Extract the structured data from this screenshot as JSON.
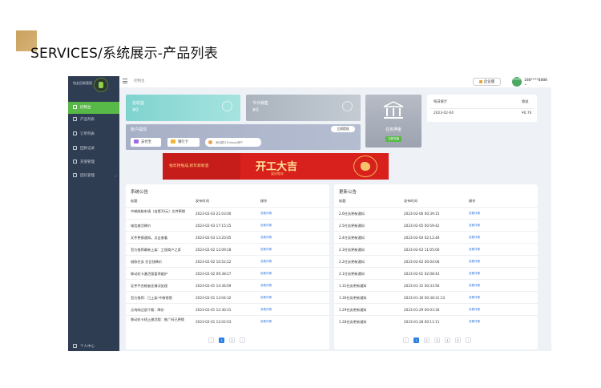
{
  "page": {
    "title": "SERVICES/系统展示-产品列表"
  },
  "sidebar": {
    "logo_text": "铭友回收管理",
    "items": [
      {
        "label": "控制台",
        "active": true
      },
      {
        "label": "产品列表",
        "active": false
      },
      {
        "label": "订单列表",
        "active": false
      },
      {
        "label": "回款记录",
        "active": false
      },
      {
        "label": "充值管理",
        "active": false
      },
      {
        "label": "团队管理",
        "active": false,
        "arrow": "›"
      }
    ],
    "user_center": "个人中心"
  },
  "topbar": {
    "breadcrumb": "控制台",
    "version_button": "企业版",
    "avatar_text": "铭友回收",
    "phone": "188****8888 ⌄"
  },
  "cards": {
    "total_earnings": {
      "label": "总收益",
      "value": "¥0"
    },
    "today_sales": {
      "label": "今日销售",
      "value": "¥0"
    },
    "task_deposit": {
      "label": "任务押金",
      "button": "立即充值"
    }
  },
  "accounts": {
    "label": "账户提现",
    "add_button": "立即提现",
    "alipay": "支付宝",
    "bank_card": "银行卡",
    "address_placeholder": "添加银行卡/alipay账户"
  },
  "banner": {
    "subtitle": "兔年持兔成,新年新新意",
    "main": "开工大吉",
    "tag": "癸卯兔年"
  },
  "daily_stats": {
    "header_date": "每日统计",
    "header_amount": "收益",
    "rows": [
      {
        "date": "2023-02-04",
        "amount": "¥0.70"
      }
    ]
  },
  "system_notice": {
    "title": "系统公告",
    "columns": [
      "标题",
      "发布时间",
      "操作"
    ],
    "rows": [
      {
        "title": "中邮邮航申请（自提10元）文件更换",
        "time": "2023-02-03 21:03:00",
        "op": "查看详情"
      },
      {
        "title": "电信激活降价",
        "time": "2023-02-03 17:15:15",
        "op": "查看详情"
      },
      {
        "title": "文件更换通知。点击查看",
        "time": "2023-02-03 13:20:05",
        "op": "查看详情"
      },
      {
        "title": "官方推荐最新上架：工银商户之家",
        "time": "2023-02-02 12:09:18",
        "op": "查看详情"
      },
      {
        "title": "借款任务 兑言钱降价",
        "time": "2023-02-02 10:52:22",
        "op": "查看详情"
      },
      {
        "title": "移动花卡激活版暂停维护",
        "time": "2023-02-02 09:38:27",
        "op": "查看详情"
      },
      {
        "title": "证件不合格者无情况处理",
        "time": "2023-02-01 14:36:09",
        "op": "查看详情"
      },
      {
        "title": "官方推荐：已上架-中移馆馆",
        "time": "2023-02-01 13:04:32",
        "op": "查看详情"
      },
      {
        "title": "点淘纯注册下载：降价",
        "time": "2023-02-01 12:30:31",
        "op": "查看详情"
      },
      {
        "title": "移动花卡线上激活版：推广码已更换",
        "time": "2023-02-01 12:02:03",
        "op": "查看详情"
      }
    ],
    "pages": [
      "‹",
      "1",
      "2",
      "›"
    ]
  },
  "update_notice": {
    "title": "更新公告",
    "columns": [
      "标题",
      "发布时间",
      "操作"
    ],
    "rows": [
      {
        "title": "2.6任务更新通知",
        "time": "2023-02-06 00:39:15",
        "op": "查看详情"
      },
      {
        "title": "2.5任务更新通知",
        "time": "2023-02-05 00:59:42",
        "op": "查看详情"
      },
      {
        "title": "2.4任务更新通知",
        "time": "2023-02-04 02:12:46",
        "op": "查看详情"
      },
      {
        "title": "2.3任务更新通知",
        "time": "2023-02-03 11:05:00",
        "op": "查看详情"
      },
      {
        "title": "2.2任务更新通知",
        "time": "2023-02-02 00:04:06",
        "op": "查看详情"
      },
      {
        "title": "2.1任务更新通知",
        "time": "2023-02-01 02:08:43",
        "op": "查看详情"
      },
      {
        "title": "1.31任务更新通知",
        "time": "2023-01-31 00:33:56",
        "op": "查看详情"
      },
      {
        "title": "1.30任务更新通知",
        "time": "2023-01-30 00:38:31:13",
        "op": "查看详情"
      },
      {
        "title": "1.29任务更新通知",
        "time": "2023-01-29 00:03:30",
        "op": "查看详情"
      },
      {
        "title": "1.28任务更新通知",
        "time": "2023-01-28 00:11:11",
        "op": "查看详情"
      }
    ],
    "pages": [
      "‹",
      "1",
      "2",
      "3",
      "4",
      "5",
      "›"
    ]
  },
  "colors": {
    "accent_green": "#58b848",
    "sidebar_bg": "#2f3d52",
    "link_blue": "#3a7be0",
    "gold": "#c9a15c"
  }
}
